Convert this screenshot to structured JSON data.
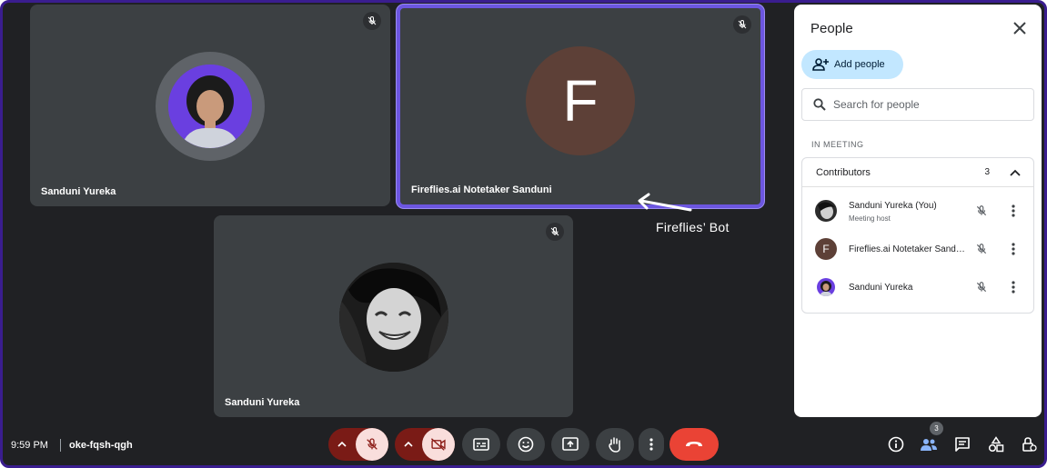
{
  "tiles": [
    {
      "name": "Sanduni Yureka"
    },
    {
      "name": "Fireflies.ai Notetaker Sanduni",
      "avatar_letter": "F"
    },
    {
      "name": "Sanduni Yureka"
    }
  ],
  "annotation": {
    "text": "Fireflies’ Bot"
  },
  "panel": {
    "title": "People",
    "add_people_label": "Add people",
    "search_placeholder": "Search for people",
    "section_label": "IN MEETING",
    "group": {
      "label": "Contributors",
      "count": "3"
    },
    "people": [
      {
        "name": "Sanduni Yureka (You)",
        "role": "Meeting host"
      },
      {
        "name": "Fireflies.ai Notetaker Sanduni",
        "avatar_letter": "F"
      },
      {
        "name": "Sanduni Yureka"
      }
    ]
  },
  "bottom": {
    "time": "9:59 PM",
    "meeting_code": "oke-fqsh-qgh",
    "participant_count": "3"
  },
  "colors": {
    "background": "#202124",
    "tile": "#3c4043",
    "active_speaker": "#6c56e0",
    "end_call": "#ea4335",
    "muted_bg": "#f9dedc",
    "add_people_bg": "#c2e7ff"
  }
}
